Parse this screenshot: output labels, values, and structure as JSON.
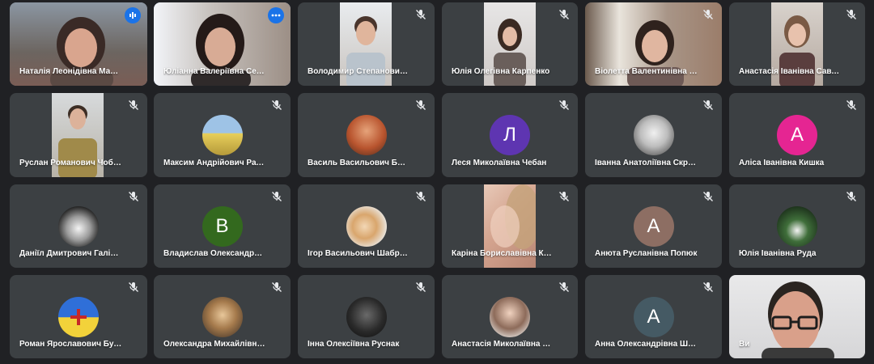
{
  "participants": [
    {
      "name": "Наталія Леонідівна Марусяк",
      "kind": "video",
      "indicator": "audio-active-badge"
    },
    {
      "name": "Юліанна Валеріївна Семенюк",
      "kind": "video",
      "indicator": "more-options-badge"
    },
    {
      "name": "Володимир Степанович Одочук",
      "kind": "video",
      "indicator": "muted"
    },
    {
      "name": "Юлія Олегівна Карпенко",
      "kind": "video",
      "indicator": "muted"
    },
    {
      "name": "Віолетта Валентинівна Штирбу",
      "kind": "video",
      "indicator": "muted"
    },
    {
      "name": "Анастасія Іванівна Савчук",
      "kind": "video",
      "indicator": "muted"
    },
    {
      "name": "Руслан Романович Чоботару",
      "kind": "video",
      "indicator": "muted"
    },
    {
      "name": "Максим Андрійович Рачинський",
      "kind": "image-avatar",
      "indicator": "muted"
    },
    {
      "name": "Василь Васильович Богданюк",
      "kind": "image-avatar",
      "indicator": "muted"
    },
    {
      "name": "Леся Миколаївна Чебан",
      "kind": "letter-avatar",
      "letter": "Л",
      "avatar_color": "#5e35b1",
      "indicator": "muted"
    },
    {
      "name": "Іванна Анатоліївна Скрипник",
      "kind": "image-avatar",
      "indicator": "muted"
    },
    {
      "name": "Аліса Іванівна Кишка",
      "kind": "letter-avatar",
      "letter": "А",
      "avatar_color": "#e52592",
      "indicator": "muted"
    },
    {
      "name": "Даніїл Дмитрович Галіщук",
      "kind": "image-avatar",
      "indicator": "muted"
    },
    {
      "name": "Владислав Олександрович Бан…",
      "kind": "letter-avatar",
      "letter": "В",
      "avatar_color": "#33691e",
      "indicator": "muted"
    },
    {
      "name": "Ігор Васильович Шабранюк",
      "kind": "image-avatar",
      "indicator": "muted"
    },
    {
      "name": "Каріна Бориславівна Китайгор…",
      "kind": "video",
      "indicator": "muted"
    },
    {
      "name": "Анюта Русланівна Попюк",
      "kind": "letter-avatar",
      "letter": "А",
      "avatar_color": "#8d6e63",
      "indicator": "muted"
    },
    {
      "name": "Юлія Іванівна Руда",
      "kind": "image-avatar",
      "indicator": "muted"
    },
    {
      "name": "Роман Ярославович Бурназа",
      "kind": "image-avatar",
      "indicator": "muted"
    },
    {
      "name": "Олександра Михайлівна Брату…",
      "kind": "image-avatar",
      "indicator": "muted"
    },
    {
      "name": "Інна Олексіївна Руснак",
      "kind": "image-avatar",
      "indicator": "muted"
    },
    {
      "name": "Анастасія Миколаївна Голковсь…",
      "kind": "image-avatar",
      "indicator": "muted"
    },
    {
      "name": "Анна Олександрівна Штирбу",
      "kind": "letter-avatar",
      "letter": "А",
      "avatar_color": "#455a64",
      "indicator": "muted"
    },
    {
      "name": "Ви",
      "kind": "self-video",
      "indicator": "none"
    }
  ],
  "colors": {
    "background": "#202124",
    "tile": "#3c4043",
    "active_outline": "#8ab4f8",
    "badge": "#1a73e8"
  }
}
